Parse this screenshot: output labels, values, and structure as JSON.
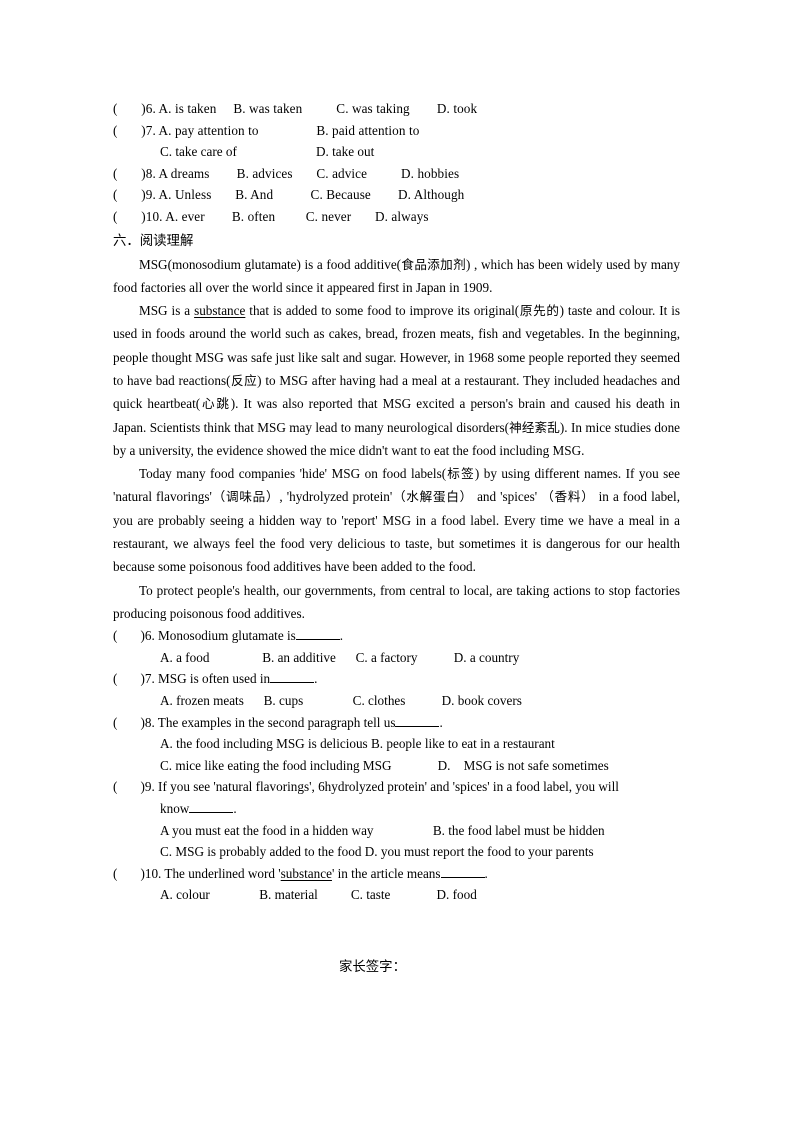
{
  "document": {
    "page_background": "#ffffff",
    "text_color": "#000000"
  },
  "cloze_options": {
    "rows": [
      {
        "marker": "(       )6.",
        "line": "(       )6. A. is taken     B. was taken          C. was taking        D. took"
      },
      {
        "marker": "(       )7.",
        "line": "(       )7. A. pay attention to                 B. paid attention to"
      },
      {
        "marker": "",
        "line": "C. take care of                        D. take out",
        "indented": true
      },
      {
        "marker": "(       )8.",
        "line": "(       )8. A dreams        B. advices       C. advice          D. hobbies"
      },
      {
        "marker": "(       )9.",
        "line": "(       )9. A. Unless       B. And           C. Because        D. Although"
      },
      {
        "marker": "(       )10.",
        "line": "(       )10. A. ever        B. often         C. never       D. always"
      }
    ]
  },
  "reading_section": {
    "heading": "六．阅读理解",
    "paragraphs": [
      {
        "id": "p1",
        "parts": [
          {
            "type": "text",
            "value": "MSG(monosodium glutamate) is a food additive("
          },
          {
            "type": "cn",
            "value": "食品添加剂"
          },
          {
            "type": "text",
            "value": ") , which has been widely used by many food factories all over the world since it appeared first in Japan in 1909."
          }
        ]
      },
      {
        "id": "p2",
        "parts": [
          {
            "type": "text",
            "value": "MSG is a "
          },
          {
            "type": "underline",
            "value": "substance"
          },
          {
            "type": "text",
            "value": " that is added to some food to improve its original("
          },
          {
            "type": "cn",
            "value": "原先的"
          },
          {
            "type": "text",
            "value": ") taste and colour. It is used in foods around the world such as cakes, bread, frozen meats, fish and vegetables. In the beginning, people thought MSG was safe just like salt and sugar. However, in 1968 some people reported they seemed to have bad reactions("
          },
          {
            "type": "cn",
            "value": "反应"
          },
          {
            "type": "text",
            "value": ") to MSG after having had a meal at a restaurant. They included headaches and quick heartbeat("
          },
          {
            "type": "cn",
            "value": "心跳"
          },
          {
            "type": "text",
            "value": "). It was also reported that MSG excited a person's brain and caused his death in Japan. Scientists think that MSG may lead to many neurological disorders("
          },
          {
            "type": "cn",
            "value": "神经紊乱"
          },
          {
            "type": "text",
            "value": "). In mice studies done by a university, the evidence showed the mice didn't want to eat the food including MSG."
          }
        ]
      },
      {
        "id": "p3",
        "parts": [
          {
            "type": "text",
            "value": "Today many food companies 'hide' MSG on food labels("
          },
          {
            "type": "cn",
            "value": "标签"
          },
          {
            "type": "text",
            "value": ") by using different names. If you see 'natural flavorings'"
          },
          {
            "type": "cn",
            "value": "（调味品）"
          },
          {
            "type": "text",
            "value": ", 'hydrolyzed protein'"
          },
          {
            "type": "cn",
            "value": "（水解蛋白）"
          },
          {
            "type": "text",
            "value": "  and 'spices'  "
          },
          {
            "type": "cn",
            "value": "（香料）"
          },
          {
            "type": "text",
            "value": " in a food label,    you are probably seeing a hidden way to 'report' MSG in a food label. Every time we have a meal in a restaurant, we always feel the food very delicious to taste, but sometimes it is dangerous for our health because some poisonous food additives have been added to the food."
          }
        ]
      },
      {
        "id": "p4",
        "parts": [
          {
            "type": "text",
            "value": "To protect people's health, our governments, from central to local, are taking actions to stop factories producing poisonous food additives."
          }
        ]
      }
    ]
  },
  "comprehension_questions": [
    {
      "number": "6",
      "stem_prefix": "(       )6. Monosodium glutamate is",
      "stem_suffix": ".",
      "options_line": "A. a food                B. an additive      C. a factory           D. a country"
    },
    {
      "number": "7",
      "stem_prefix": "(       )7. MSG is often used in",
      "stem_suffix": ".",
      "options_line": "A. frozen meats      B. cups               C. clothes           D. book covers"
    },
    {
      "number": "8",
      "stem_prefix": "(       )8. The examples in the second paragraph tell us",
      "stem_suffix": ".",
      "options_justified": "A.  the  food  including  MSG  is  delicious                     B.  people  like  to  eat  in  a restaurant",
      "options_line2": "C. mice like eating the food including MSG              D.    MSG is not safe sometimes"
    },
    {
      "number": "9",
      "stem_line1": "(       )9. If you see 'natural flavorings', 6hydrolyzed protein' and 'spices' in a food label, you will",
      "stem_line2_prefix": "know",
      "stem_line2_suffix": ".",
      "options_justified": "A you must eat the food in a hidden way                  B. the food label must be hidden",
      "options_justified2": "C.  MSG  is  probably  added  to  the  food            D.  you  must  report  the  food  to  your parents"
    },
    {
      "number": "10",
      "stem_prefix": "(       )10. The underlined word '",
      "stem_underlined": "substance",
      "stem_middle": "' in the article means",
      "stem_suffix": ".",
      "options_line": "A. colour               B. material          C. taste              D. food"
    }
  ],
  "footer": {
    "signature_label": "家长签字："
  }
}
